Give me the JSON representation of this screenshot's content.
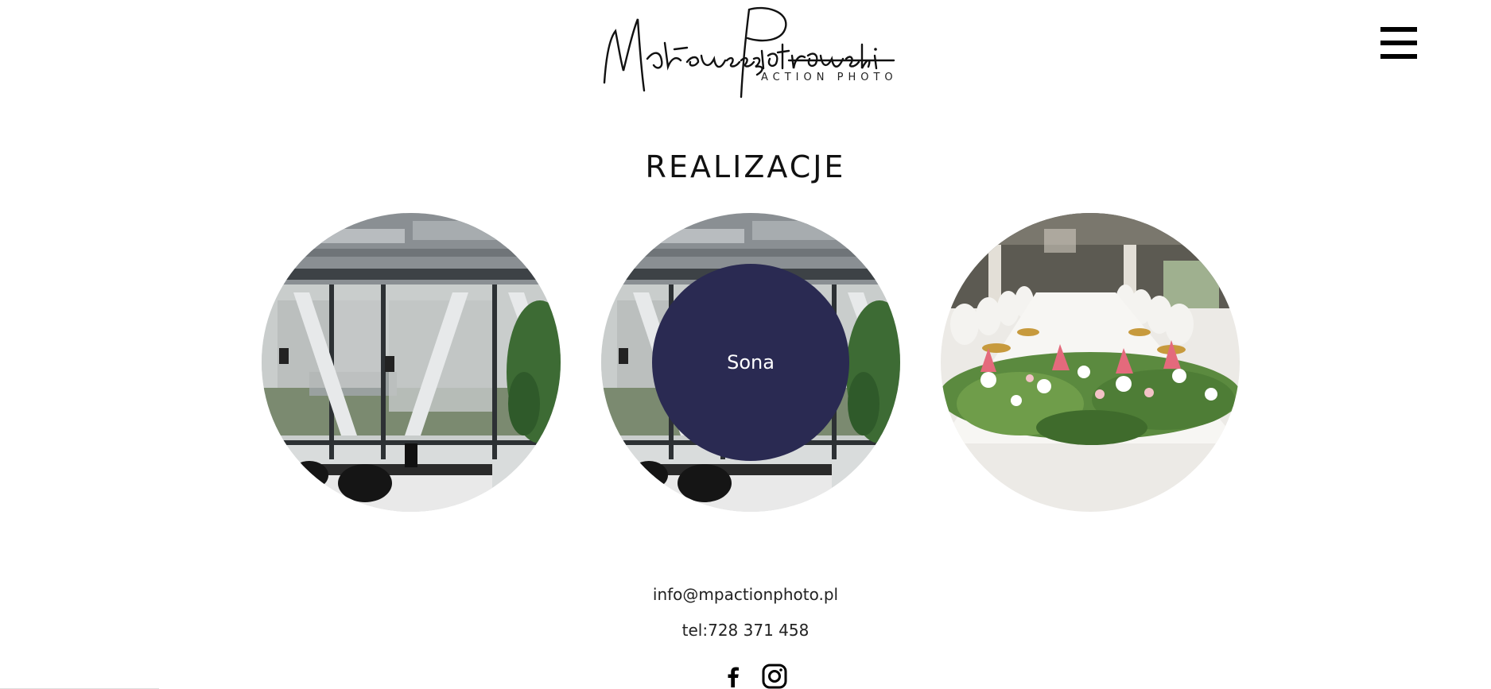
{
  "header": {
    "logo_script": "Mateusz Piotrowski",
    "logo_sub": "ACTION PHOTO",
    "menu_icon": "hamburger-icon"
  },
  "main": {
    "title": "REALIZACJE",
    "gallery": [
      {
        "image": "office-interior-photo",
        "label": ""
      },
      {
        "image": "office-interior-photo",
        "label": "Sona"
      },
      {
        "image": "wedding-table-flowers-photo",
        "label": ""
      }
    ]
  },
  "footer": {
    "email": "info@mpactionphoto.pl",
    "tel": "tel:728 371 458",
    "social": [
      {
        "icon": "facebook-icon"
      },
      {
        "icon": "instagram-icon"
      }
    ]
  },
  "colors": {
    "overlay": "#2a2a52",
    "text": "#111111",
    "background": "#ffffff"
  }
}
